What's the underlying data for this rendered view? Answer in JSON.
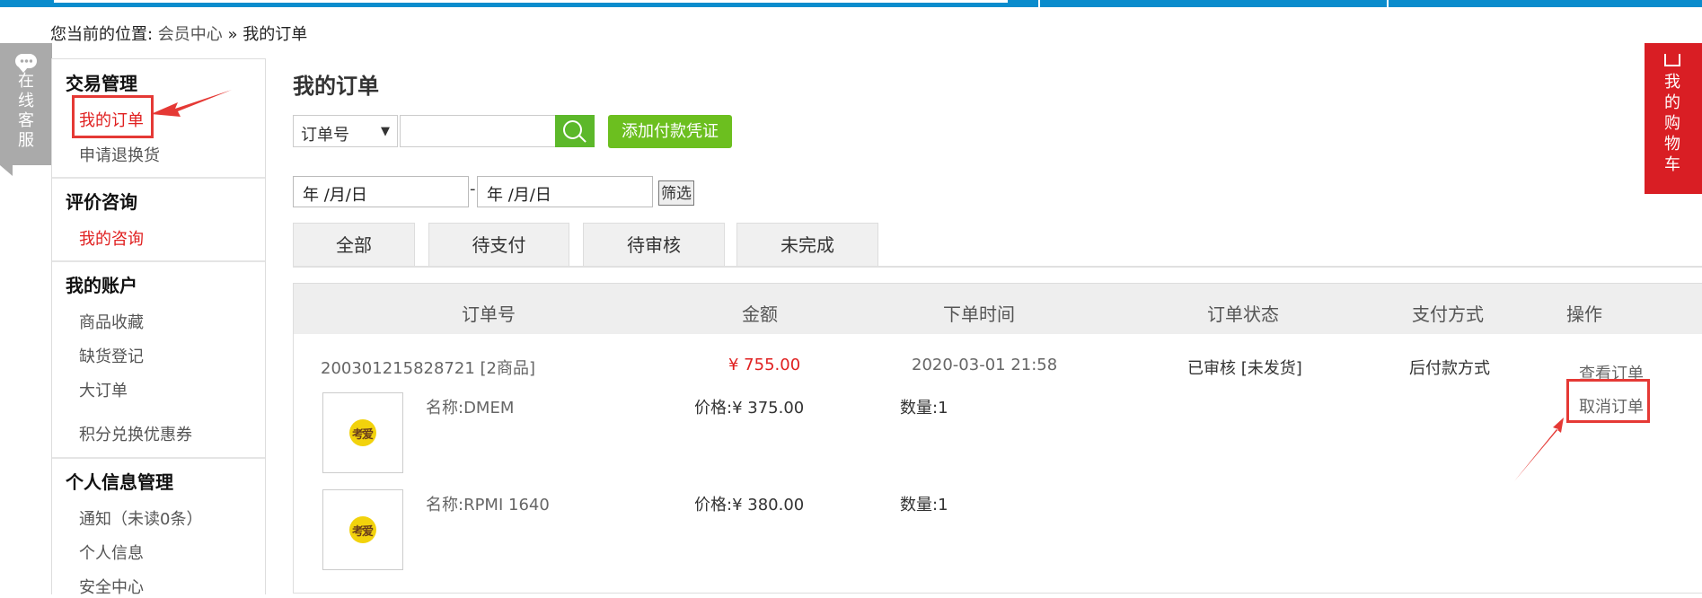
{
  "breadcrumb": {
    "prefix": "您当前的位置: ",
    "home": "会员中心",
    "sep": " » ",
    "current": "我的订单"
  },
  "service": {
    "label": "在线客服"
  },
  "cart": {
    "label": "我的购物车"
  },
  "sidebar": {
    "groups": [
      {
        "title": "交易管理",
        "items": [
          "我的订单",
          "申请退换货"
        ]
      },
      {
        "title": "评价咨询",
        "items": [
          "我的咨询"
        ]
      },
      {
        "title": "我的账户",
        "items": [
          "商品收藏",
          "缺货登记",
          "大订单",
          "积分兑换优惠券"
        ]
      },
      {
        "title": "个人信息管理",
        "items": [
          "通知（未读0条）",
          "个人信息",
          "安全中心"
        ]
      }
    ]
  },
  "main": {
    "title": "我的订单",
    "search_select": "订单号",
    "search_input_value": "",
    "add_button": "添加付款凭证",
    "date_from": "年 /月/日",
    "date_to": "年 /月/日",
    "date_dash": "-",
    "filter_button": "筛选",
    "tabs": [
      "全部",
      "待支付",
      "待审核",
      "未完成"
    ]
  },
  "table": {
    "headers": [
      "订单号",
      "金额",
      "下单时间",
      "订单状态",
      "支付方式",
      "操作"
    ],
    "order": {
      "number": "200301215828721 [2商品]",
      "amount": "¥ 755.00",
      "time": "2020-03-01 21:58",
      "status": "已审核 [未发货]",
      "payment": "后付款方式",
      "actions": [
        "查看订单",
        "取消订单"
      ],
      "items": [
        {
          "name": "名称:DMEM",
          "price": "价格:¥ 375.00",
          "qty": "数量:1",
          "logo_text": "考爱"
        },
        {
          "name": "名称:RPMI 1640",
          "price": "价格:¥ 380.00",
          "qty": "数量:1",
          "logo_text": "考爱"
        }
      ]
    }
  },
  "colors": {
    "accent_blue": "#0a8ccd",
    "button_green": "#6cbf1f",
    "price_red": "#e02020",
    "annotation_red": "#e53935",
    "cart_red": "#d91e24"
  }
}
